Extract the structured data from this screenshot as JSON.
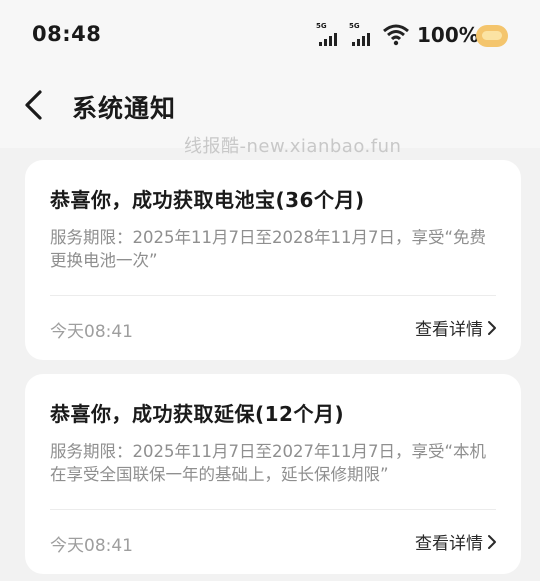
{
  "status_bar": {
    "time": "08:48",
    "network_badge_1": "5G",
    "network_badge_2": "5G",
    "battery": "100%"
  },
  "header": {
    "title": "系统通知",
    "watermark": "线报酷-new.xianbao.fun"
  },
  "notifications": [
    {
      "title": "恭喜你，成功获取电池宝(36个月)",
      "description": "服务期限：2025年11月7日至2028年11月7日，享受“免费更换电池一次”",
      "timestamp": "今天08:41",
      "action_label": "查看详情"
    },
    {
      "title": "恭喜你，成功获取延保(12个月)",
      "description": "服务期限：2025年11月7日至2027年11月7日，享受“本机在享受全国联保一年的基础上，延长保修期限”",
      "timestamp": "今天08:41",
      "action_label": "查看详情"
    }
  ],
  "colors": {
    "background": "#f2f2f2",
    "card": "#ffffff",
    "muted_text": "#8f8f8f"
  }
}
